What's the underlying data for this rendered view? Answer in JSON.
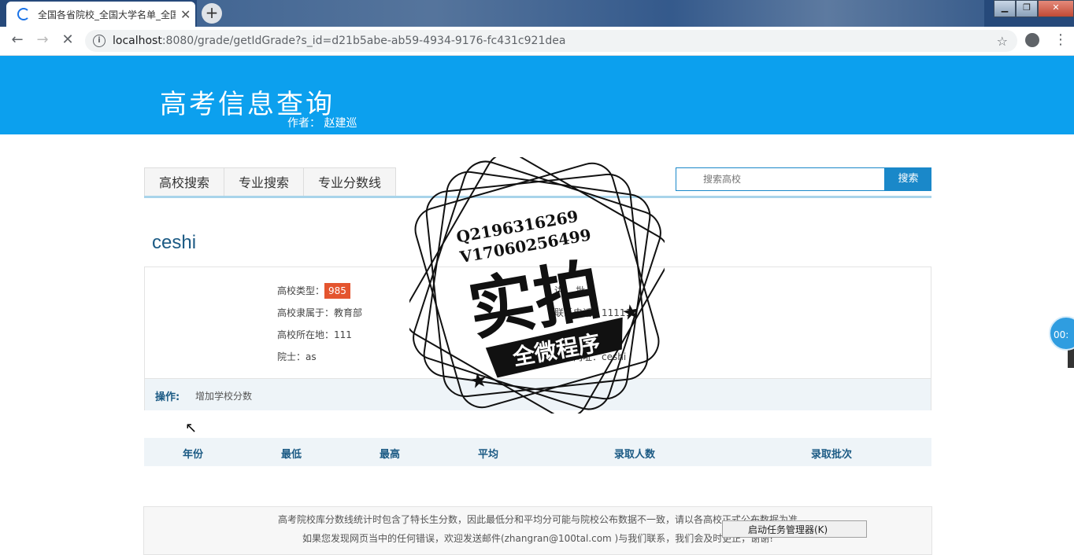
{
  "browser": {
    "tab_title": "全国各省院校_全国大学名单_全国",
    "new_tab": "+",
    "url_host": "localhost",
    "url_rest": ":8080/grade/getIdGrade?s_id=d21b5abe-ab59-4934-9176-fc431c921dea"
  },
  "header": {
    "logo": "高考信息查询",
    "author": "作者： 赵建巡"
  },
  "nav": {
    "tabs": [
      "高校搜索",
      "专业搜索",
      "专业分数线"
    ]
  },
  "search": {
    "placeholder": "搜索高校",
    "button": "搜索"
  },
  "school": {
    "name": "ceshi",
    "type_label": "高校类型：",
    "type_value": "985",
    "affiliation": "高校隶属于：教育部",
    "location": "高校所在地：111",
    "academician": "院士：as",
    "right_col": [
      "讲... 批",
      "联系电话：11111",
      "...hi",
      "学校网址：ceshi"
    ]
  },
  "operations": {
    "label": "操作:",
    "add_score": "增加学校分数"
  },
  "score_table": {
    "headers": [
      "年份",
      "最低",
      "最高",
      "平均",
      "录取人数",
      "录取批次"
    ]
  },
  "footer": {
    "line1": "高考院校库分数线统计时包含了特长生分数，因此最低分和平均分可能与院校公布数据不一致，请以各高校正式公布数据为准",
    "line2": "如果您发现网页当中的任何错误，欢迎发送邮件(zhangran@100tal.com )与我们联系，我们会及时更正，谢谢!"
  },
  "context_menu": {
    "item": "启动任务管理器(K)"
  },
  "overlay": {
    "timer": "00:",
    "stamp_line1": "Q2196316269",
    "stamp_line2": "V17060256499",
    "stamp_big": "实拍",
    "stamp_ribbon": "全微程序"
  }
}
